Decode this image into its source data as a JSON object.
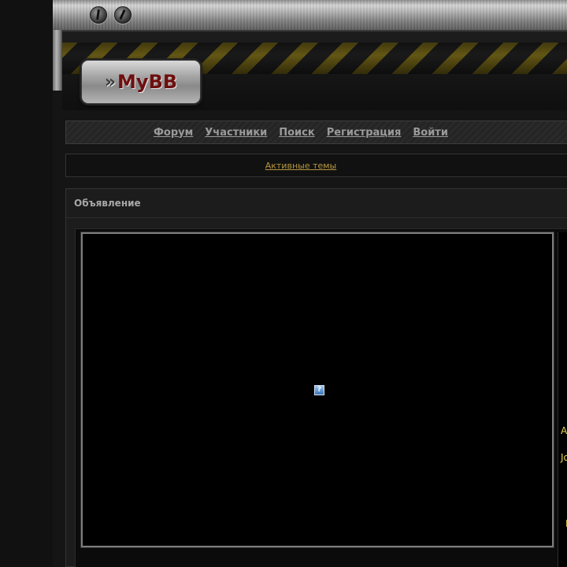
{
  "header": {
    "logo_text": "MyBB",
    "logo_chevron": "»"
  },
  "nav": {
    "items": [
      "Форум",
      "Участники",
      "Поиск",
      "Регистрация",
      "Войти"
    ]
  },
  "subnav": {
    "active_topics": "Активные темы"
  },
  "announcement": {
    "title": "Объявление",
    "broken_image_glyph": "?",
    "clipped_side_text": [
      "A",
      "Jo",
      "I"
    ]
  },
  "colors": {
    "link_gold": "#b5963e",
    "nav_text": "#9a9a9a",
    "side_text_yellow": "#e8d450",
    "logo_red": "#6e0f0f"
  },
  "icons": [
    "screw-icon",
    "logo-chevron-icon",
    "broken-image-icon"
  ]
}
